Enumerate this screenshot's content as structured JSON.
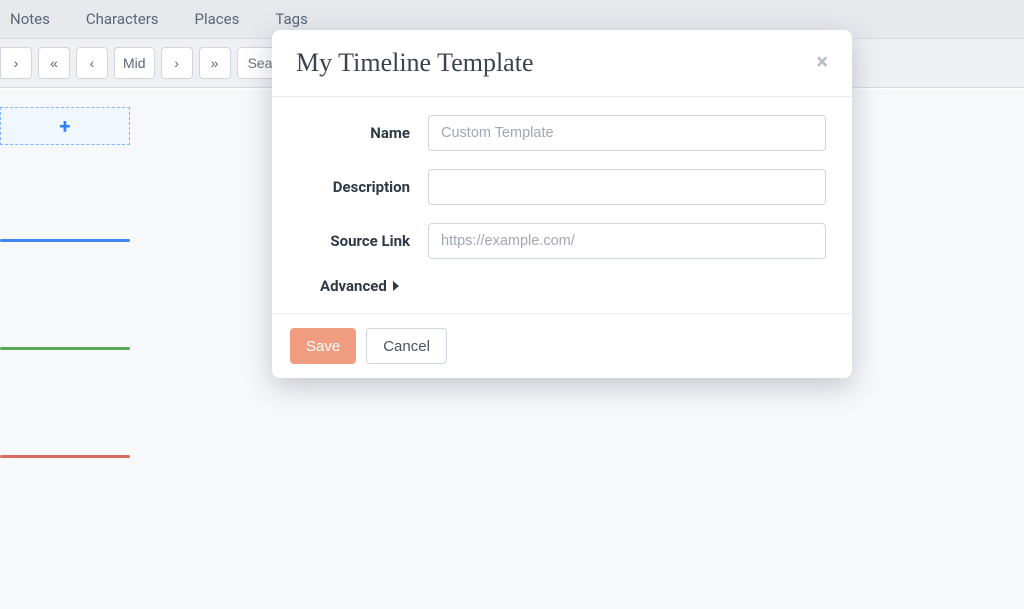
{
  "tabs": {
    "notes": "Notes",
    "characters": "Characters",
    "places": "Places",
    "tags": "Tags"
  },
  "toolbar": {
    "zoom_label": "Mid",
    "search_placeholder": "Search"
  },
  "add_box_icon": "+",
  "modal": {
    "title": "My Timeline Template",
    "close_glyph": "×",
    "labels": {
      "name": "Name",
      "description": "Description",
      "source": "Source Link",
      "advanced": "Advanced"
    },
    "placeholders": {
      "name": "Custom Template",
      "source": "https://example.com/"
    },
    "values": {
      "name": "",
      "description": "",
      "source": ""
    },
    "buttons": {
      "save": "Save",
      "cancel": "Cancel"
    }
  }
}
